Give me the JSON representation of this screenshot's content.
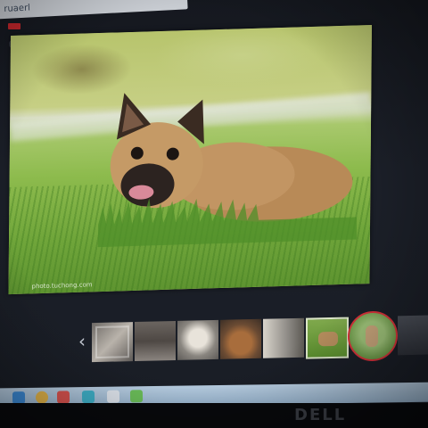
{
  "browser": {
    "tab_text": "ruaerl"
  },
  "viewer": {
    "watermark": "photo.tuchong.com"
  },
  "thumbnails": {
    "prev_glyph": "‹",
    "items": [
      {
        "name": "Dog thumbnail 1"
      },
      {
        "name": "Dog thumbnail 2"
      },
      {
        "name": "Dog thumbnail 3"
      },
      {
        "name": "Dog thumbnail 4"
      },
      {
        "name": "Dog thumbnail 5"
      },
      {
        "name": "French bulldog thumbnail"
      },
      {
        "name": "Whippet thumbnail"
      },
      {
        "name": "Dog thumbnail 8"
      }
    ]
  },
  "monitor": {
    "brand": "DELL"
  },
  "colors": {
    "highlight_ring": "#d7323a",
    "taskbar": "#a9c2da"
  }
}
